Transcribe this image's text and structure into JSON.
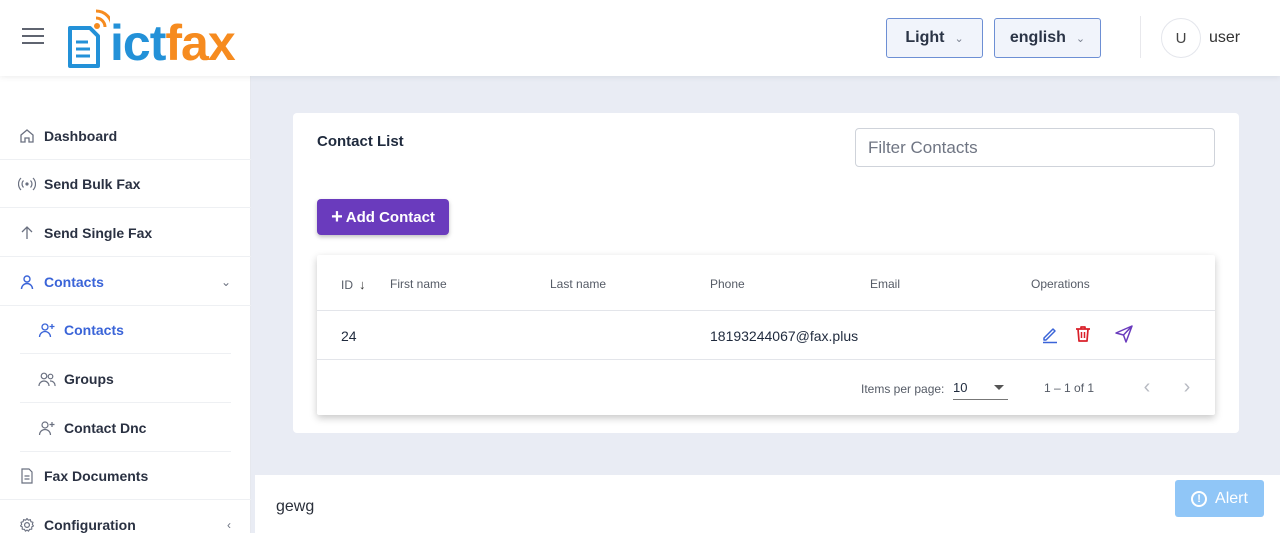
{
  "header": {
    "logo_ict": "ict",
    "logo_fax": "fax",
    "theme_label": "Light",
    "language_label": "english",
    "avatar_initial": "U",
    "username": "user",
    "brand_blue": "#2391d8",
    "brand_orange": "#f68b1f"
  },
  "sidebar": {
    "items": [
      {
        "label": "Dashboard",
        "icon": "home-icon"
      },
      {
        "label": "Send Bulk Fax",
        "icon": "broadcast-icon"
      },
      {
        "label": "Send Single Fax",
        "icon": "arrow-up-icon"
      },
      {
        "label": "Contacts",
        "icon": "user-icon",
        "expanded": true
      },
      {
        "label": "Contacts",
        "icon": "user-add-icon",
        "active": true
      },
      {
        "label": "Groups",
        "icon": "users-icon"
      },
      {
        "label": "Contact Dnc",
        "icon": "user-add-icon"
      },
      {
        "label": "Fax Documents",
        "icon": "document-icon"
      },
      {
        "label": "Configuration",
        "icon": "gear-icon"
      }
    ],
    "accent_color": "#3a64d8"
  },
  "main": {
    "title": "Contact List",
    "filter_placeholder": "Filter Contacts",
    "add_button_label": "Add Contact",
    "add_button_color": "#6a3bbd",
    "table": {
      "headers": {
        "id": "ID",
        "first_name": "First name",
        "last_name": "Last name",
        "phone": "Phone",
        "email": "Email",
        "operations": "Operations"
      },
      "rows": [
        {
          "id": "24",
          "first_name": "",
          "last_name": "",
          "phone": "18193244067@fax.plus",
          "email": ""
        }
      ]
    },
    "paginator": {
      "items_per_page_label": "Items per page:",
      "items_per_page_value": "10",
      "range_label": "1 – 1 of 1"
    }
  },
  "footer": {
    "text": "gewg",
    "alert_label": "Alert",
    "alert_color": "#90c6f7"
  }
}
